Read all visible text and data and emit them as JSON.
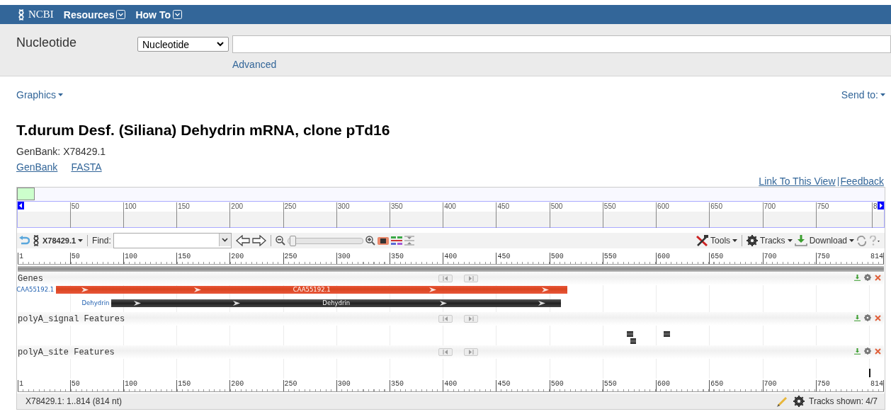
{
  "header": {
    "logo": "NCBI",
    "menus": [
      {
        "label": "Resources"
      },
      {
        "label": "How To"
      }
    ]
  },
  "search": {
    "database_label": "Nucleotide",
    "database_select": "Nucleotide",
    "advanced_link": "Advanced"
  },
  "graphics_menu": "Graphics",
  "send_to": "Send to:",
  "record": {
    "title": "T.durum Desf. (Siliana) Dehydrin mRNA, clone pTd16",
    "accession_line": "GenBank: X78429.1",
    "format_links": [
      "GenBank",
      "FASTA"
    ]
  },
  "viewer": {
    "view_links": [
      "Link To This View",
      "Feedback"
    ],
    "overview_ticks": [
      "50",
      "100",
      "150",
      "200",
      "250",
      "300",
      "350",
      "400",
      "450",
      "500",
      "550",
      "600",
      "650",
      "700",
      "750",
      "8"
    ],
    "toolbar": {
      "sequence_menu": "X78429.1",
      "find_label": "Find:",
      "zoom_slider": {
        "level": 0.02
      },
      "tools": "Tools",
      "tracks": "Tracks",
      "download": "Download"
    },
    "ruler_ticks": [
      "1",
      "50",
      "100",
      "150",
      "200",
      "250",
      "300",
      "350",
      "400",
      "450",
      "500",
      "550",
      "600",
      "650",
      "700",
      "750",
      "814"
    ],
    "bottom_ruler_ticks": [
      "1",
      "50",
      "100",
      "150",
      "200",
      "250",
      "300",
      "350",
      "400",
      "450",
      "500",
      "550",
      "600",
      "650",
      "700",
      "750",
      "814"
    ],
    "tracks": [
      {
        "name": "Genes",
        "features": [
          {
            "kind": "cds",
            "label": "CAA55192.1",
            "inner_label": "CAA55192.1"
          },
          {
            "kind": "gene",
            "label": "Dehydrin",
            "inner_label": "Dehydrin"
          }
        ]
      },
      {
        "name": "polyA_signal Features",
        "features": [
          {
            "kind": "block"
          },
          {
            "kind": "block"
          },
          {
            "kind": "block"
          }
        ]
      },
      {
        "name": "polyA_site Features",
        "features": [
          {
            "kind": "site"
          }
        ]
      }
    ],
    "status": "X78429.1: 1..814 (814 nt)",
    "tracks_shown": "Tracks shown: 4/7"
  }
}
